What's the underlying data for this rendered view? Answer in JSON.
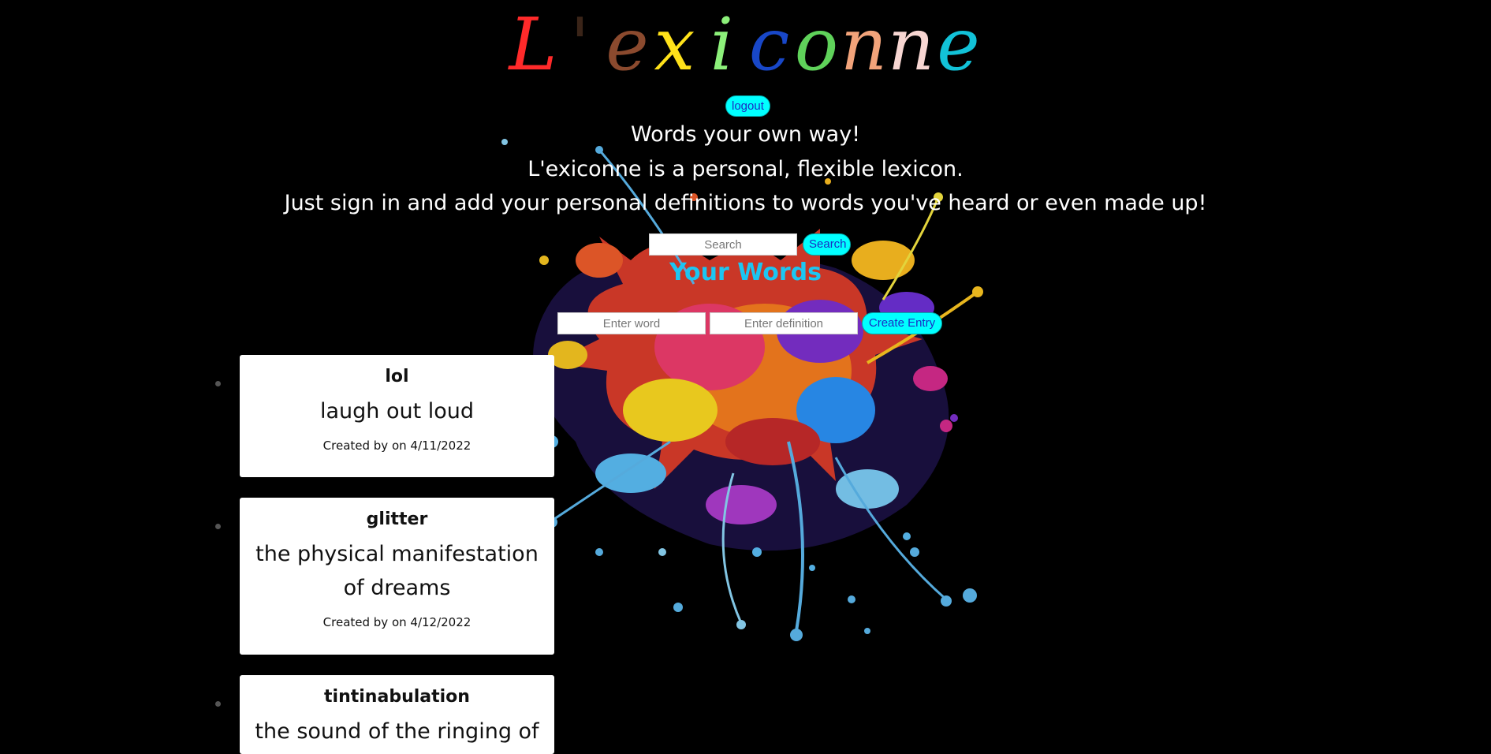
{
  "app": {
    "logo_letters": [
      "L",
      "'",
      "e",
      "x",
      "i",
      "c",
      "o",
      "n",
      "n",
      "e"
    ],
    "logo_colors": [
      "#ff2a2a",
      "#3a2418",
      "#8b4a2e",
      "#ffe21a",
      "#8cf07a",
      "#1847c8",
      "#5fd25a",
      "#f2a37a",
      "#f7d6d2",
      "#12c2d8"
    ],
    "logout_label": "logout"
  },
  "tagline": {
    "line1": "Words your own way!",
    "line2": "L'exiconne is a personal, flexible lexicon.",
    "line3": "Just sign in and add your personal definitions to words you've heard or even made up!"
  },
  "search": {
    "placeholder": "Search",
    "button_label": "Search"
  },
  "section": {
    "title": "Your Words"
  },
  "entry_form": {
    "word_placeholder": "Enter word",
    "definition_placeholder": "Enter definition",
    "button_label": "Create Entry"
  },
  "words": [
    {
      "word": "lol",
      "definition": "laugh out loud",
      "created": "Created by on 4/11/2022"
    },
    {
      "word": "glitter",
      "definition": "the physical manifestation of dreams",
      "created": "Created by on 4/12/2022"
    },
    {
      "word": "tintinabulation",
      "definition": "the sound of the ringing of",
      "created": ""
    }
  ],
  "colors": {
    "accent_button": "#00ffff",
    "accent_button_text": "#1b2cc4",
    "heading": "#1cc6f2",
    "background": "#000000"
  }
}
